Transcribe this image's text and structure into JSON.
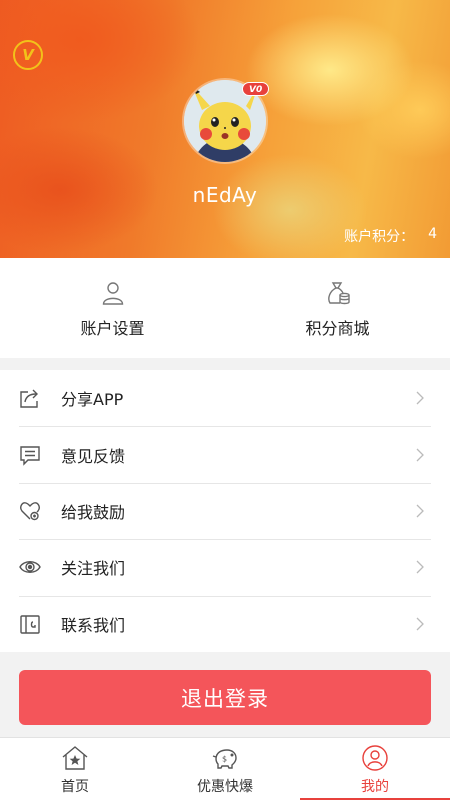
{
  "profile": {
    "vip_badge": "V",
    "level_tag": "V0",
    "username": "nEdAy",
    "points_label": "账户积分：",
    "points_value": "4"
  },
  "shortcuts": [
    {
      "label": "账户设置",
      "icon": "user-icon"
    },
    {
      "label": "积分商城",
      "icon": "money-bag-icon"
    }
  ],
  "menu": [
    {
      "label": "分享APP",
      "icon": "share-icon"
    },
    {
      "label": "意见反馈",
      "icon": "feedback-icon"
    },
    {
      "label": "给我鼓励",
      "icon": "heart-icon"
    },
    {
      "label": "关注我们",
      "icon": "eye-icon"
    },
    {
      "label": "联系我们",
      "icon": "contact-icon"
    }
  ],
  "logout_label": "退出登录",
  "tabs": [
    {
      "label": "首页",
      "icon": "home-icon",
      "active": false
    },
    {
      "label": "优惠快爆",
      "icon": "piggy-bank-icon",
      "active": false
    },
    {
      "label": "我的",
      "icon": "profile-icon",
      "active": true
    }
  ],
  "colors": {
    "accent": "#e8413c",
    "logout_button": "#f4555a",
    "vip_gold": "#f2c21a"
  }
}
